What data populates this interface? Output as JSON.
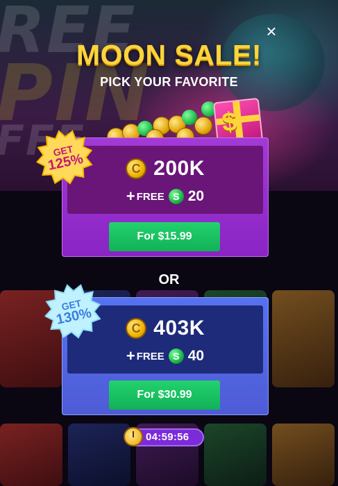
{
  "modal": {
    "title": "MOON SALE!",
    "subtitle": "PICK YOUR FAVORITE",
    "close_glyph": "×",
    "or_label": "OR"
  },
  "offers": [
    {
      "badge_top": "GET",
      "badge_percent": "125%",
      "coin_glyph": "C",
      "coins": "200K",
      "free_prefix": "+",
      "free_label": "FREE",
      "cash_glyph": "S",
      "free_amount": "20",
      "price_label": "For $15.99"
    },
    {
      "badge_top": "GET",
      "badge_percent": "130%",
      "coin_glyph": "C",
      "coins": "403K",
      "free_prefix": "+",
      "free_label": "FREE",
      "cash_glyph": "S",
      "free_amount": "40",
      "price_label": "For $30.99"
    }
  ],
  "timer": {
    "icon": "stopwatch-icon",
    "time": "04:59:56"
  },
  "icons": [
    "close-icon",
    "gold-coin-icon",
    "cash-coin-icon",
    "gift-box-icon",
    "stopwatch-icon"
  ],
  "colors": {
    "title_gold": "#ffd43b",
    "offer1_card": "#a23ad6",
    "offer2_card": "#5572f0",
    "buy_button": "#1cc463",
    "timer_pill": "#7b2bd8"
  }
}
